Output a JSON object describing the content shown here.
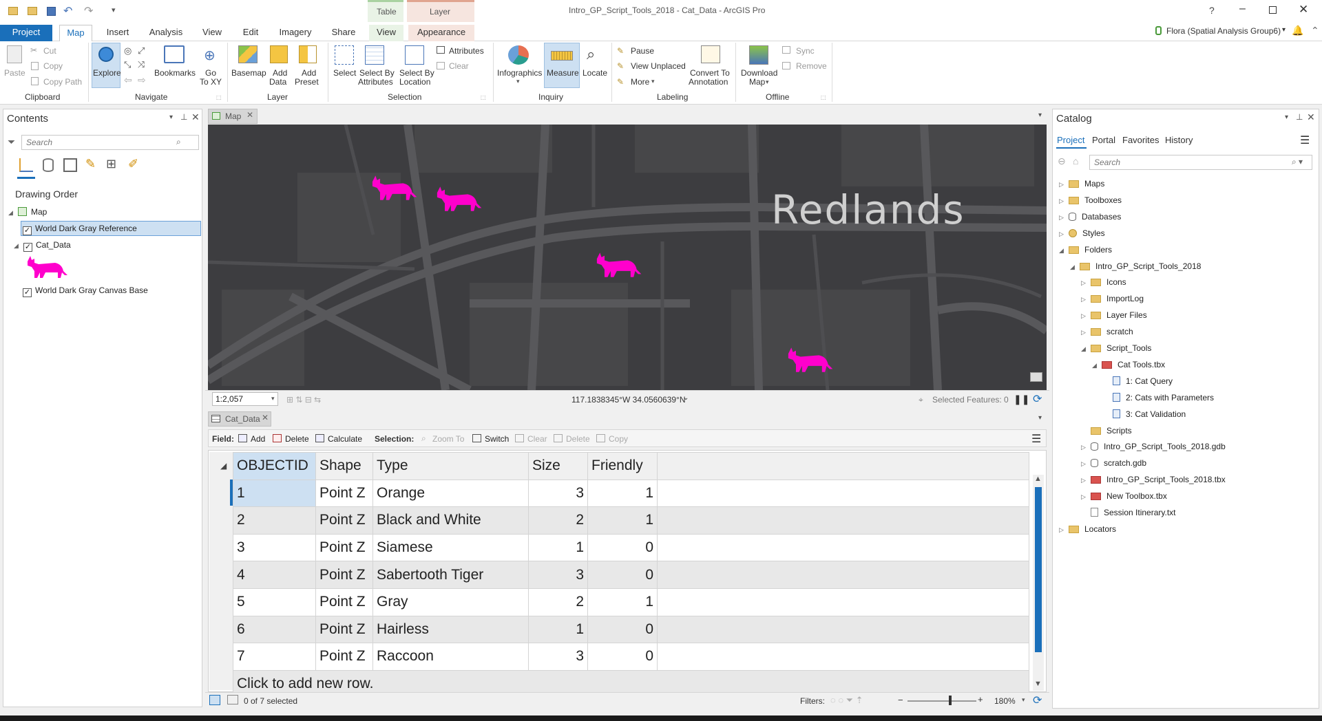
{
  "window": {
    "title": "Intro_GP_Script_Tools_2018 - Cat_Data - ArcGIS Pro",
    "help": "?",
    "user": "Flora (Spatial Analysis Group6)",
    "user_caret": "▾"
  },
  "contextual": {
    "table_group": "Table",
    "layer_group": "Layer",
    "table_color": "#cde5c9",
    "layer_color": "#e7b09f"
  },
  "tabs": [
    "Project",
    "Map",
    "Insert",
    "Analysis",
    "View",
    "Edit",
    "Imagery",
    "Share",
    "View",
    "Appearance"
  ],
  "ribbon": {
    "clipboard": {
      "paste": "Paste",
      "cut": "Cut",
      "copy": "Copy",
      "copy_path": "Copy Path",
      "label": "Clipboard"
    },
    "navigate": {
      "explore": "Explore",
      "bookmarks": "Bookmarks",
      "goto": "Go\nTo XY",
      "goto1": "Go",
      "goto2": "To XY",
      "label": "Navigate"
    },
    "layer": {
      "basemap": "Basemap",
      "add_data1": "Add",
      "add_data2": "Data",
      "add_preset1": "Add",
      "add_preset2": "Preset",
      "label": "Layer"
    },
    "selection": {
      "select": "Select",
      "by_attr1": "Select By",
      "by_attr2": "Attributes",
      "by_loc1": "Select By",
      "by_loc2": "Location",
      "attributes": "Attributes",
      "clear": "Clear",
      "label": "Selection"
    },
    "inquiry": {
      "infographics": "Infographics",
      "measure": "Measure",
      "locate": "Locate",
      "label": "Inquiry"
    },
    "labeling": {
      "pause": "Pause",
      "view_unplaced": "View Unplaced",
      "more": "More",
      "convert1": "Convert To",
      "convert2": "Annotation",
      "label": "Labeling"
    },
    "offline": {
      "download1": "Download",
      "download2": "Map",
      "sync": "Sync",
      "remove": "Remove",
      "label": "Offline"
    }
  },
  "contents": {
    "title": "Contents",
    "search_placeholder": "Search",
    "drawing_order": "Drawing Order",
    "map": "Map",
    "layers": [
      "World Dark Gray Reference",
      "Cat_Data",
      "World Dark Gray Canvas Base"
    ]
  },
  "map_view": {
    "tab": "Map",
    "label_redlands": "Redlands",
    "scale": "1:2,057",
    "coords": "117.1838345°W 34.0560639°N",
    "selected_features": "Selected Features: 0"
  },
  "table_view": {
    "tab": "Cat_Data",
    "field_label": "Field:",
    "add": "Add",
    "delete": "Delete",
    "calculate": "Calculate",
    "selection_label": "Selection:",
    "zoom_to": "Zoom To",
    "switch": "Switch",
    "clear": "Clear",
    "delete_sel": "Delete",
    "copy": "Copy",
    "columns": [
      "OBJECTID",
      "Shape",
      "Type",
      "Size",
      "Friendly"
    ],
    "rows": [
      [
        "1",
        "Point Z",
        "Orange",
        "3",
        "1"
      ],
      [
        "2",
        "Point Z",
        "Black and White",
        "2",
        "1"
      ],
      [
        "3",
        "Point Z",
        "Siamese",
        "1",
        "0"
      ],
      [
        "4",
        "Point Z",
        "Sabertooth Tiger",
        "3",
        "0"
      ],
      [
        "5",
        "Point Z",
        "Gray",
        "2",
        "1"
      ],
      [
        "6",
        "Point Z",
        "Hairless",
        "1",
        "0"
      ],
      [
        "7",
        "Point Z",
        "Raccoon",
        "3",
        "0"
      ]
    ],
    "add_row": "Click to add new row.",
    "selected_count": "0 of 7 selected",
    "filters": "Filters:",
    "zoom_pct": "180%"
  },
  "catalog": {
    "title": "Catalog",
    "tabs": [
      "Project",
      "Portal",
      "Favorites",
      "History"
    ],
    "search_placeholder": "Search",
    "items": [
      "Maps",
      "Toolboxes",
      "Databases",
      "Styles",
      "Folders",
      "Intro_GP_Script_Tools_2018",
      "Icons",
      "ImportLog",
      "Layer Files",
      "scratch",
      "Script_Tools",
      "Cat Tools.tbx",
      "1: Cat Query",
      "2: Cats with Parameters",
      "3: Cat Validation",
      "Scripts",
      "Intro_GP_Script_Tools_2018.gdb",
      "scratch.gdb",
      "Intro_GP_Script_Tools_2018.tbx",
      "New Toolbox.tbx",
      "Session Itinerary.txt",
      "Locators"
    ]
  },
  "colors": {
    "accent": "#1a6fba",
    "cat": "#ff00cc",
    "map_bg": "#3d3d40"
  }
}
